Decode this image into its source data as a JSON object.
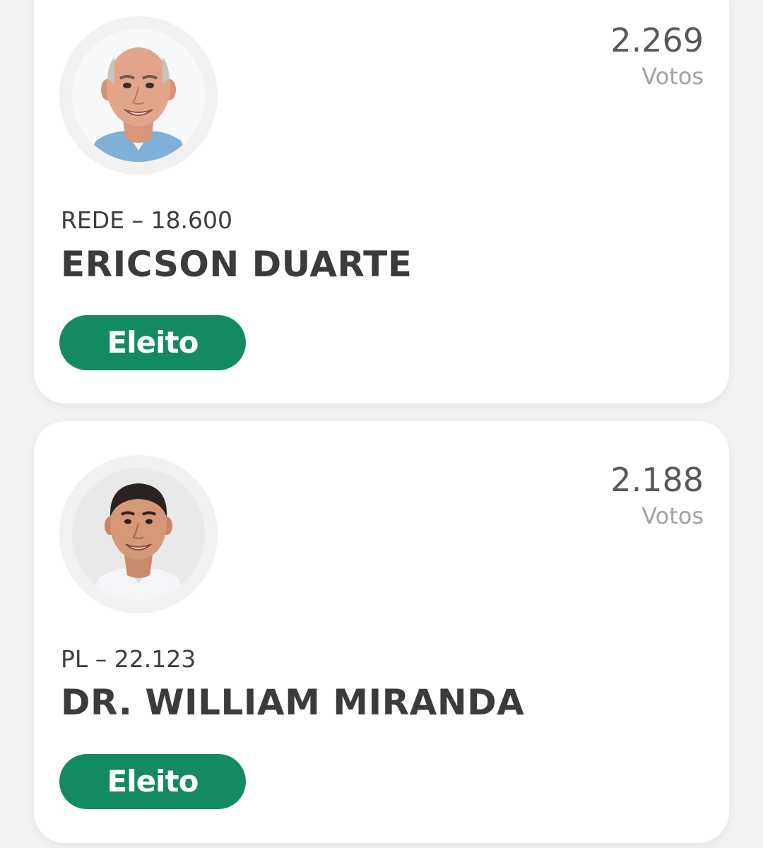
{
  "candidates": [
    {
      "party_number": "REDE – 18.600",
      "name": "ERICSON DUARTE",
      "votes_count": "2.269",
      "votes_label": "Votos",
      "status": "Eleito",
      "status_color": "#148a60",
      "photo": "candidate-photo-ericson-duarte"
    },
    {
      "party_number": "PL – 22.123",
      "name": "DR. WILLIAM MIRANDA",
      "votes_count": "2.188",
      "votes_label": "Votos",
      "status": "Eleito",
      "status_color": "#148a60",
      "photo": "candidate-photo-william-miranda"
    }
  ]
}
